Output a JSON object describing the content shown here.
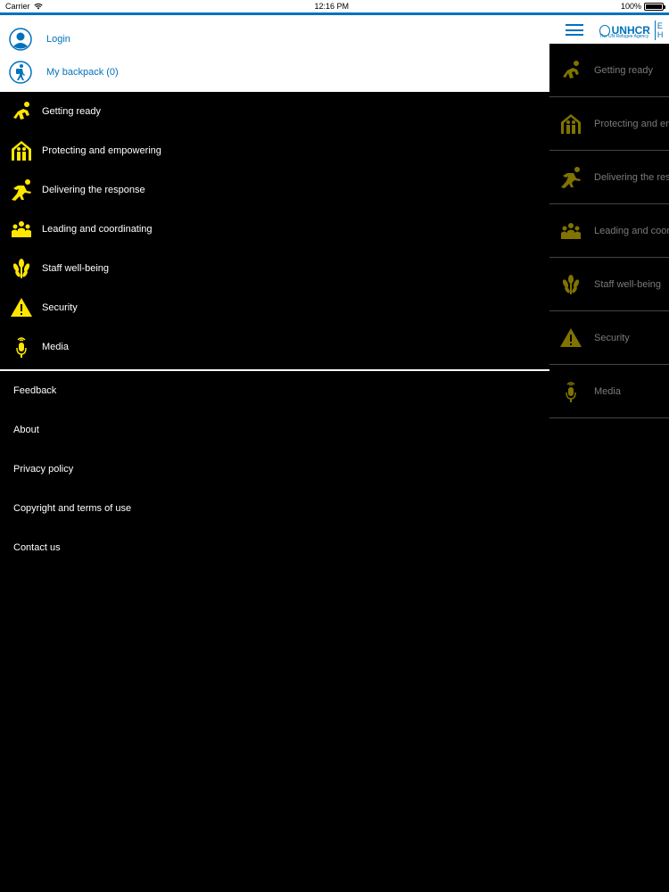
{
  "status_bar": {
    "carrier": "Carrier",
    "time": "12:16 PM",
    "battery": "100%"
  },
  "colors": {
    "accent": "#0072bc",
    "icon_yellow": "#ffe600",
    "background": "#000000"
  },
  "header": {
    "logo_text": "UNHCR",
    "logo_subtext": "The UN Refugee Agency",
    "logo_side_text": "E H"
  },
  "account": {
    "login_label": "Login",
    "backpack_label": "My backpack (0)"
  },
  "menu": [
    {
      "label": "Getting ready",
      "icon": "crouching-runner-icon"
    },
    {
      "label": "Protecting and empowering",
      "icon": "sheltered-family-icon"
    },
    {
      "label": "Delivering the response",
      "icon": "sprinting-person-icon"
    },
    {
      "label": "Leading and coordinating",
      "icon": "group-icon"
    },
    {
      "label": "Staff well-being",
      "icon": "wheat-icon"
    },
    {
      "label": "Security",
      "icon": "warning-icon"
    },
    {
      "label": "Media",
      "icon": "microphone-icon"
    }
  ],
  "main_list": [
    {
      "label": "Getting ready"
    },
    {
      "label": "Protecting and en"
    },
    {
      "label": "Delivering the res"
    },
    {
      "label": "Leading and coor"
    },
    {
      "label": "Staff well-being"
    },
    {
      "label": "Security"
    },
    {
      "label": "Media"
    }
  ],
  "links": [
    {
      "label": "Feedback"
    },
    {
      "label": "About"
    },
    {
      "label": "Privacy policy"
    },
    {
      "label": "Copyright and terms of use"
    },
    {
      "label": "Contact us"
    }
  ]
}
